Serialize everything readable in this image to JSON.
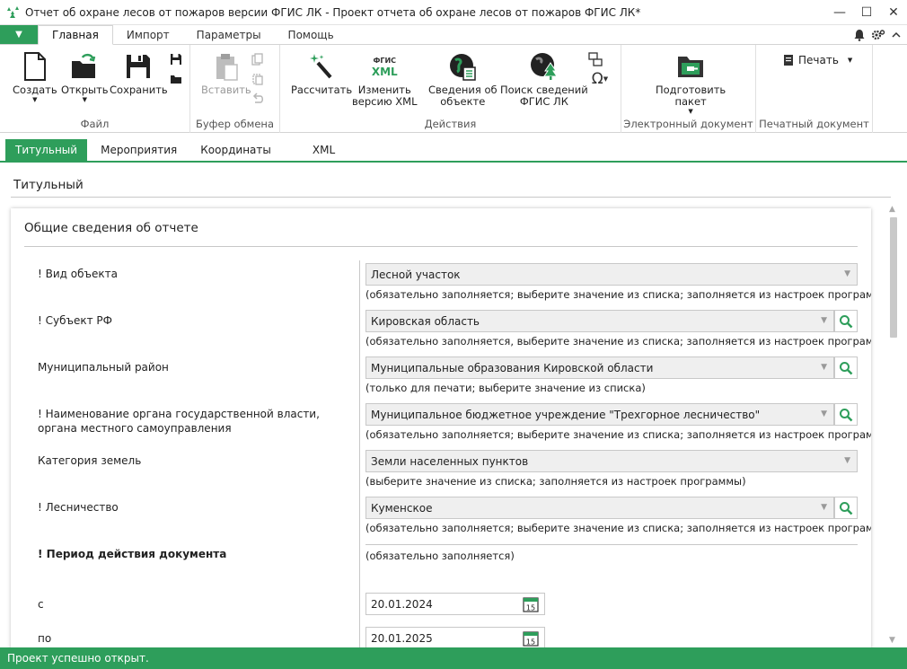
{
  "window": {
    "title": "Отчет об охране лесов от пожаров версии ФГИС ЛК - Проект отчета об охране лесов от пожаров ФГИС ЛК*",
    "minimize_glyph": "—",
    "maximize_glyph": "☐",
    "close_glyph": "✕"
  },
  "ribbon_tabs": {
    "file_glyph": "▼",
    "items": [
      "Главная",
      "Импорт",
      "Параметры",
      "Помощь"
    ]
  },
  "ribbon": {
    "file_group": {
      "label": "Файл",
      "create": "Создать",
      "open": "Открыть",
      "save": "Сохранить"
    },
    "clipboard_group": {
      "label": "Буфер обмена",
      "paste": "Вставить"
    },
    "actions_group": {
      "label": "Действия",
      "calculate": "Рассчитать",
      "change_xml_1": "Изменить",
      "change_xml_2": "версию XML",
      "object_info_1": "Сведения об",
      "object_info_2": "объекте",
      "search_info_1": "Поиск сведений",
      "search_info_2": "ФГИС ЛК",
      "xml_icon_top": "ФГИС",
      "xml_icon_bottom": "XML"
    },
    "edoc_group": {
      "label": "Электронный документ",
      "prepare_1": "Подготовить",
      "prepare_2": "пакет"
    },
    "print_group": {
      "label": "Печатный документ",
      "print": "Печать"
    }
  },
  "content_tabs": [
    "Титульный",
    "Мероприятия",
    "Координаты",
    "XML"
  ],
  "section_title": "Титульный",
  "card": {
    "title": "Общие сведения об отчете",
    "fields": [
      {
        "label": "! Вид объекта",
        "value": "Лесной участок",
        "hint": "(обязательно заполняется; выберите значение из списка; заполняется из настроек программы)"
      },
      {
        "label": "! Субъект РФ",
        "value": "Кировская область",
        "hint": "(обязательно заполняется, выберите значение из списка; заполняется из настроек программы)"
      },
      {
        "label": "Муниципальный район",
        "value": "Муниципальные образования Кировской области",
        "hint": "(только для печати; выберите значение из списка)"
      },
      {
        "label": "! Наименование органа государственной власти, органа местного самоуправления",
        "value": "Муниципальное бюджетное учреждение \"Трехгорное лесничество\"",
        "hint": "(обязательно заполняется; выберите значение из списка; заполняется из настроек программы)"
      },
      {
        "label": "Категория земель",
        "value": "Земли населенных пунктов",
        "hint": "(выберите значение из списка; заполняется из настроек программы)"
      },
      {
        "label": "! Лесничество",
        "value": "Куменское",
        "hint": "(обязательно заполняется; выберите значение из списка; заполняется из настроек программы)"
      }
    ],
    "period": {
      "label": "! Период действия документа",
      "hint": "(обязательно заполняется)",
      "from_label": "с",
      "from_value": "20.01.2024",
      "to_label": "по",
      "to_value": "20.01.2025",
      "calendar_day": "15"
    }
  },
  "status": "Проект успешно открыт.",
  "colors": {
    "accent": "#2e9e5b"
  }
}
